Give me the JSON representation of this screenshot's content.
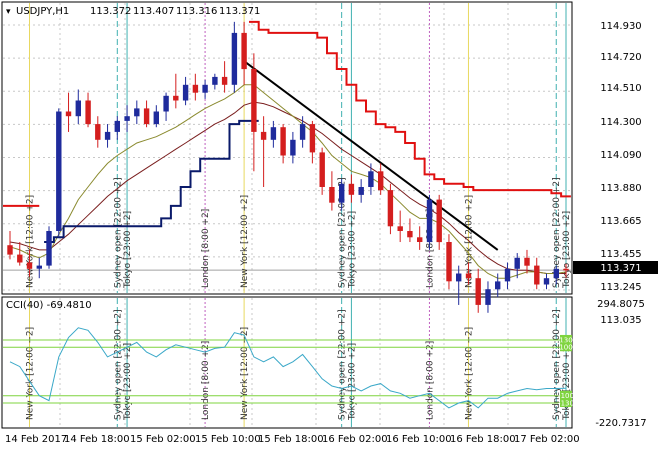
{
  "header": {
    "symbol": "USDJPY,H1",
    "open": "113.372",
    "high": "113.407",
    "low": "113.316",
    "close": "113.371"
  },
  "price_axis": {
    "labels": [
      "114.930",
      "114.720",
      "114.510",
      "114.300",
      "114.090",
      "113.880",
      "113.665",
      "113.455",
      "113.245",
      "113.035"
    ],
    "current": "113.371"
  },
  "time_axis": {
    "labels": [
      "14 Feb 2017",
      "14 Feb 18:00",
      "15 Feb 02:00",
      "15 Feb 10:00",
      "15 Feb 18:00",
      "16 Feb 02:00",
      "16 Feb 10:00",
      "16 Feb 18:00",
      "17 Feb 02:00"
    ]
  },
  "session_labels": {
    "new_york": "New York  [12:00 +2]",
    "sydney": "Sydney open  [22:00 +2]",
    "tokyo": "Tokyo  [23:00 +2]",
    "london": "London  [8:00 +2]"
  },
  "indicator": {
    "label": "CCI(40) -69.4810",
    "top_value": "294.8075",
    "bottom_value": "-220.7317",
    "level_labels": [
      "130",
      "100",
      "-100",
      "-130"
    ]
  },
  "colors": {
    "bull": "#1f2b9c",
    "bear": "#d41e1e",
    "fast_ma": "#8a8a2e",
    "slow_ma": "#7a1e1e",
    "cci": "#3aa8c8",
    "level": "#7fd43f",
    "resistance": "#e01010",
    "support": "#0a1a6a",
    "trendline": "#000000"
  },
  "chart_data": {
    "type": "candlestick",
    "title": "USDJPY,H1",
    "ylim": [
      113.035,
      114.995
    ],
    "current_price": 113.371,
    "candles": [
      {
        "o": 113.53,
        "h": 113.62,
        "l": 113.44,
        "c": 113.47
      },
      {
        "o": 113.47,
        "h": 113.55,
        "l": 113.4,
        "c": 113.42
      },
      {
        "o": 113.42,
        "h": 113.5,
        "l": 113.33,
        "c": 113.38
      },
      {
        "o": 113.38,
        "h": 113.45,
        "l": 113.32,
        "c": 113.4
      },
      {
        "o": 113.4,
        "h": 113.65,
        "l": 113.38,
        "c": 113.62
      },
      {
        "o": 113.62,
        "h": 114.4,
        "l": 113.58,
        "c": 114.38
      },
      {
        "o": 114.38,
        "h": 114.5,
        "l": 114.25,
        "c": 114.35
      },
      {
        "o": 114.35,
        "h": 114.52,
        "l": 114.3,
        "c": 114.45
      },
      {
        "o": 114.45,
        "h": 114.5,
        "l": 114.28,
        "c": 114.3
      },
      {
        "o": 114.3,
        "h": 114.35,
        "l": 114.15,
        "c": 114.2
      },
      {
        "o": 114.2,
        "h": 114.3,
        "l": 114.15,
        "c": 114.25
      },
      {
        "o": 114.25,
        "h": 114.35,
        "l": 114.2,
        "c": 114.32
      },
      {
        "o": 114.32,
        "h": 114.42,
        "l": 114.25,
        "c": 114.35
      },
      {
        "o": 114.35,
        "h": 114.45,
        "l": 114.3,
        "c": 114.4
      },
      {
        "o": 114.4,
        "h": 114.45,
        "l": 114.28,
        "c": 114.3
      },
      {
        "o": 114.3,
        "h": 114.42,
        "l": 114.28,
        "c": 114.38
      },
      {
        "o": 114.38,
        "h": 114.5,
        "l": 114.32,
        "c": 114.48
      },
      {
        "o": 114.48,
        "h": 114.62,
        "l": 114.4,
        "c": 114.45
      },
      {
        "o": 114.45,
        "h": 114.6,
        "l": 114.42,
        "c": 114.55
      },
      {
        "o": 114.55,
        "h": 114.62,
        "l": 114.45,
        "c": 114.5
      },
      {
        "o": 114.5,
        "h": 114.58,
        "l": 114.46,
        "c": 114.55
      },
      {
        "o": 114.55,
        "h": 114.62,
        "l": 114.52,
        "c": 114.6
      },
      {
        "o": 114.6,
        "h": 114.7,
        "l": 114.5,
        "c": 114.55
      },
      {
        "o": 114.55,
        "h": 114.95,
        "l": 114.5,
        "c": 114.88
      },
      {
        "o": 114.88,
        "h": 114.95,
        "l": 114.55,
        "c": 114.65
      },
      {
        "o": 114.65,
        "h": 114.75,
        "l": 114.0,
        "c": 114.25
      },
      {
        "o": 114.25,
        "h": 114.35,
        "l": 113.9,
        "c": 114.2
      },
      {
        "o": 114.2,
        "h": 114.32,
        "l": 114.15,
        "c": 114.28
      },
      {
        "o": 114.28,
        "h": 114.3,
        "l": 114.05,
        "c": 114.1
      },
      {
        "o": 114.1,
        "h": 114.25,
        "l": 114.05,
        "c": 114.2
      },
      {
        "o": 114.2,
        "h": 114.35,
        "l": 114.15,
        "c": 114.3
      },
      {
        "o": 114.3,
        "h": 114.32,
        "l": 114.05,
        "c": 114.12
      },
      {
        "o": 114.12,
        "h": 114.15,
        "l": 113.85,
        "c": 113.9
      },
      {
        "o": 113.9,
        "h": 114.0,
        "l": 113.75,
        "c": 113.8
      },
      {
        "o": 113.8,
        "h": 113.95,
        "l": 113.75,
        "c": 113.92
      },
      {
        "o": 113.92,
        "h": 113.98,
        "l": 113.8,
        "c": 113.85
      },
      {
        "o": 113.85,
        "h": 113.95,
        "l": 113.8,
        "c": 113.9
      },
      {
        "o": 113.9,
        "h": 114.05,
        "l": 113.85,
        "c": 114.0
      },
      {
        "o": 114.0,
        "h": 114.05,
        "l": 113.85,
        "c": 113.88
      },
      {
        "o": 113.88,
        "h": 113.92,
        "l": 113.6,
        "c": 113.65
      },
      {
        "o": 113.65,
        "h": 113.75,
        "l": 113.55,
        "c": 113.62
      },
      {
        "o": 113.62,
        "h": 113.7,
        "l": 113.55,
        "c": 113.58
      },
      {
        "o": 113.58,
        "h": 113.65,
        "l": 113.5,
        "c": 113.55
      },
      {
        "o": 113.55,
        "h": 113.85,
        "l": 113.5,
        "c": 113.82
      },
      {
        "o": 113.82,
        "h": 113.85,
        "l": 113.5,
        "c": 113.55
      },
      {
        "o": 113.55,
        "h": 113.6,
        "l": 113.25,
        "c": 113.3
      },
      {
        "o": 113.3,
        "h": 113.4,
        "l": 113.15,
        "c": 113.35
      },
      {
        "o": 113.35,
        "h": 113.42,
        "l": 113.28,
        "c": 113.32
      },
      {
        "o": 113.32,
        "h": 113.38,
        "l": 113.1,
        "c": 113.15
      },
      {
        "o": 113.15,
        "h": 113.3,
        "l": 113.1,
        "c": 113.25
      },
      {
        "o": 113.25,
        "h": 113.35,
        "l": 113.2,
        "c": 113.3
      },
      {
        "o": 113.3,
        "h": 113.42,
        "l": 113.25,
        "c": 113.38
      },
      {
        "o": 113.38,
        "h": 113.48,
        "l": 113.32,
        "c": 113.45
      },
      {
        "o": 113.45,
        "h": 113.5,
        "l": 113.35,
        "c": 113.4
      },
      {
        "o": 113.4,
        "h": 113.45,
        "l": 113.25,
        "c": 113.28
      },
      {
        "o": 113.28,
        "h": 113.35,
        "l": 113.25,
        "c": 113.32
      },
      {
        "o": 113.32,
        "h": 113.4,
        "l": 113.28,
        "c": 113.38
      },
      {
        "o": 113.38,
        "h": 113.41,
        "l": 113.32,
        "c": 113.37
      }
    ],
    "fast_ma": [
      113.52,
      113.5,
      113.47,
      113.45,
      113.48,
      113.6,
      113.7,
      113.82,
      113.9,
      113.98,
      114.05,
      114.1,
      114.14,
      114.18,
      114.2,
      114.22,
      114.25,
      114.28,
      114.32,
      114.36,
      114.4,
      114.43,
      114.46,
      114.5,
      114.55,
      114.55,
      114.5,
      114.45,
      114.4,
      114.35,
      114.3,
      114.25,
      114.18,
      114.1,
      114.05,
      114.0,
      113.98,
      113.96,
      113.92,
      113.86,
      113.8,
      113.74,
      113.7,
      113.7,
      113.67,
      113.62,
      113.55,
      113.48,
      113.4,
      113.35,
      113.32,
      113.32,
      113.34,
      113.36,
      113.36,
      113.35,
      113.35,
      113.36
    ],
    "slow_ma": [
      113.55,
      113.54,
      113.52,
      113.5,
      113.5,
      113.55,
      113.6,
      113.66,
      113.72,
      113.78,
      113.84,
      113.89,
      113.94,
      113.98,
      114.02,
      114.06,
      114.1,
      114.14,
      114.18,
      114.22,
      114.26,
      114.3,
      114.33,
      114.37,
      114.42,
      114.44,
      114.43,
      114.41,
      114.38,
      114.35,
      114.32,
      114.28,
      114.24,
      114.19,
      114.14,
      114.1,
      114.06,
      114.02,
      113.98,
      113.93,
      113.88,
      113.83,
      113.79,
      113.76,
      113.72,
      113.67,
      113.61,
      113.56,
      113.5,
      113.45,
      113.41,
      113.38,
      113.37,
      113.37,
      113.36,
      113.35,
      113.35,
      113.35
    ],
    "resistance": [
      null,
      null,
      null,
      null,
      null,
      null,
      null,
      null,
      null,
      null,
      null,
      null,
      null,
      null,
      null,
      null,
      null,
      null,
      null,
      null,
      null,
      null,
      null,
      null,
      null,
      114.95,
      114.9,
      114.88,
      114.88,
      114.88,
      114.88,
      114.88,
      114.85,
      114.75,
      114.65,
      114.55,
      114.45,
      114.38,
      114.3,
      114.28,
      114.25,
      114.18,
      114.08,
      113.98,
      113.95,
      113.92,
      113.92,
      113.9,
      113.88,
      113.88,
      113.88,
      113.88,
      113.88,
      113.88,
      113.88,
      113.88,
      113.86,
      113.84
    ],
    "support": [
      null,
      null,
      null,
      null,
      113.55,
      113.58,
      113.65,
      113.65,
      113.65,
      113.65,
      113.65,
      113.65,
      113.65,
      113.65,
      113.65,
      113.65,
      113.7,
      113.78,
      113.9,
      114.0,
      114.08,
      114.08,
      114.08,
      114.3,
      114.32,
      114.32,
      null,
      null,
      null,
      null,
      null,
      null,
      null,
      null,
      null,
      null,
      null,
      null,
      null,
      null,
      null,
      null,
      null,
      null,
      null,
      null,
      null,
      null,
      null,
      null,
      null,
      null,
      null,
      null,
      null,
      null,
      null,
      null
    ],
    "trendline": {
      "from_index": 24,
      "from_value": 114.7,
      "to_index": 50,
      "to_value": 113.5
    },
    "initial_level": 113.78,
    "cci": [
      40,
      20,
      -40,
      -100,
      -120,
      60,
      140,
      180,
      170,
      120,
      60,
      80,
      100,
      120,
      80,
      60,
      90,
      110,
      100,
      90,
      80,
      95,
      100,
      160,
      150,
      60,
      40,
      60,
      20,
      40,
      70,
      20,
      -30,
      -60,
      -70,
      -60,
      -80,
      -60,
      -50,
      -80,
      -90,
      -110,
      -100,
      -90,
      -120,
      -150,
      -130,
      -120,
      -150,
      -110,
      -110,
      -90,
      -80,
      -70,
      -75,
      -70,
      -70,
      -69
    ],
    "cci_levels": [
      130,
      100,
      -100,
      -130
    ],
    "cci_range": [
      -220.7317,
      294.8075
    ],
    "vertical_lines": [
      {
        "index": 2,
        "kind": "new_york"
      },
      {
        "index": 11,
        "kind": "sydney"
      },
      {
        "index": 12,
        "kind": "tokyo"
      },
      {
        "index": 20,
        "kind": "london"
      },
      {
        "index": 24,
        "kind": "new_york"
      },
      {
        "index": 34,
        "kind": "sydney"
      },
      {
        "index": 35,
        "kind": "tokyo"
      },
      {
        "index": 43,
        "kind": "london"
      },
      {
        "index": 47,
        "kind": "new_york"
      },
      {
        "index": 56,
        "kind": "sydney"
      },
      {
        "index": 57,
        "kind": "tokyo"
      }
    ]
  }
}
